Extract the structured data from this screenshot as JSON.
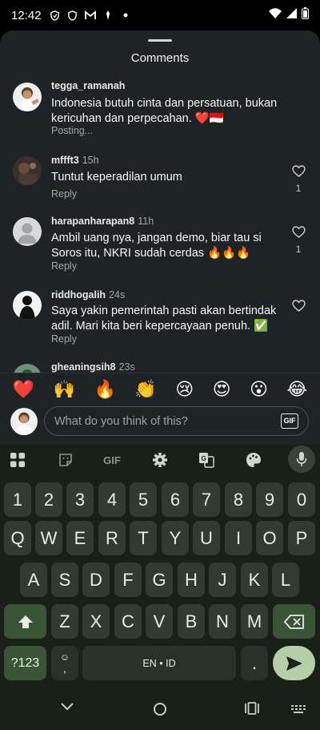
{
  "status_bar": {
    "time": "12:42",
    "left_icons": [
      "shield-icon",
      "shield-outline-icon",
      "gmail-icon",
      "pin-icon",
      "dot-icon"
    ],
    "right_icons": [
      "wifi-icon",
      "signal-icon",
      "battery-icon"
    ]
  },
  "sheet": {
    "title": "Comments"
  },
  "comments": [
    {
      "username": "tegga_ramanah",
      "time": "",
      "text": "Indonesia butuh cinta dan persatuan, bukan kericuhan dan perpecahan. ❤️🇮🇩",
      "action": "Posting...",
      "likes": ""
    },
    {
      "username": "mffft3",
      "time": "15h",
      "text": "Tuntut keperadilan umum",
      "action": "Reply",
      "likes": "1"
    },
    {
      "username": "harapanharapan8",
      "time": "11h",
      "text": "Ambil uang nya, jangan demo, biar tau si Soros itu, NKRI sudah cerdas 🔥🔥🔥",
      "action": "Reply",
      "likes": "1"
    },
    {
      "username": "riddhogalih",
      "time": "24s",
      "text": "Saya yakin pemerintah pasti akan bertindak adil. Mari kita beri kepercayaan penuh. ✅",
      "action": "Reply",
      "likes": ""
    },
    {
      "username": "gheaningsih8",
      "time": "23s",
      "text": "",
      "action": "",
      "likes": ""
    }
  ],
  "reactions": [
    "❤️",
    "🙌",
    "🔥",
    "👏",
    "😢",
    "😍",
    "😮",
    "😂"
  ],
  "composer": {
    "placeholder": "What do you think of this?",
    "gif_label": "GIF"
  },
  "keyboard": {
    "toolbar": {
      "gif_label": "GIF",
      "icons": [
        "apps-grid-icon",
        "sticker-icon",
        "gif-icon",
        "settings-gear-icon",
        "translate-icon",
        "palette-icon",
        "mic-icon"
      ]
    },
    "row_numbers": [
      "1",
      "2",
      "3",
      "4",
      "5",
      "6",
      "7",
      "8",
      "9",
      "0"
    ],
    "row_1": [
      "Q",
      "W",
      "E",
      "R",
      "T",
      "Y",
      "U",
      "I",
      "O",
      "P"
    ],
    "row_2": [
      "A",
      "S",
      "D",
      "F",
      "G",
      "H",
      "J",
      "K",
      "L"
    ],
    "row_3": [
      "Z",
      "X",
      "C",
      "V",
      "B",
      "N",
      "M"
    ],
    "symbols_label": "?123",
    "comma_label": ",",
    "space_label": "EN • ID",
    "period_label": "."
  },
  "nav_bar": {
    "icons": [
      "back-chevron-icon",
      "home-circle-icon",
      "recents-icon",
      "keyboard-switch-icon"
    ]
  }
}
